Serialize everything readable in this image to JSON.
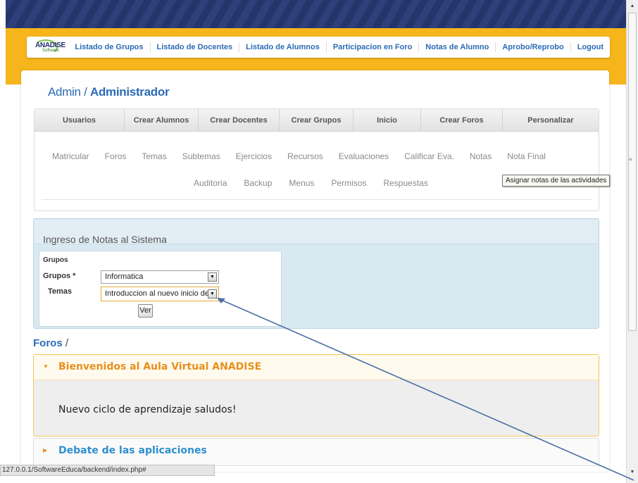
{
  "topnav": {
    "logo": "ANADISE",
    "logo_sub": "Software",
    "items": [
      "Listado de Grupos",
      "Listado de Docentes",
      "Listado de Alumnos",
      "Participacion en Foro",
      "Notas de Alumno",
      "Aprobo/Reprobo",
      "Logout"
    ]
  },
  "header": {
    "role": "Admin /",
    "user": "Administrador"
  },
  "tabs": [
    "Usuarios",
    "Crear Alumnos",
    "Crear Docentes",
    "Crear Grupos",
    "Inicio",
    "Crear Foros",
    "Personalizar"
  ],
  "submenu": {
    "row1": [
      "Matricular",
      "Foros",
      "Temas",
      "Subtemas",
      "Ejercicios",
      "Recursos",
      "Evaluaciones",
      "Calificar Eva.",
      "Notas",
      "Nota Final"
    ],
    "row2": [
      "Auditoria",
      "Backup",
      "Menus",
      "Permisos",
      "Respuestas"
    ]
  },
  "tooltip": "Asignar notas de las actividades",
  "form": {
    "title": "Ingreso de Notas al Sistema",
    "section": "Grupos",
    "grupos_label": "Grupos *",
    "grupos_value": "Informatica",
    "temas_label": "Temas",
    "temas_value": "Introduccion al nuevo inicio de",
    "submit": "Ver"
  },
  "foros": {
    "title": "Foros",
    "sep": "/",
    "items": [
      {
        "title": "Bienvenidos al Aula Virtual ANADISE",
        "body": "Nuevo ciclo de aprendizaje saludos!"
      },
      {
        "title": "Debate de las aplicaciones"
      }
    ]
  },
  "status": "127.0.0.1/SoftwareEduca/backend/index.php#",
  "colors": {
    "banner": "#2e3f7c",
    "accent": "#f7b51c",
    "link": "#2b6bb5",
    "forum_open": "#e7901c",
    "forum_closed": "#2e8fcf"
  }
}
